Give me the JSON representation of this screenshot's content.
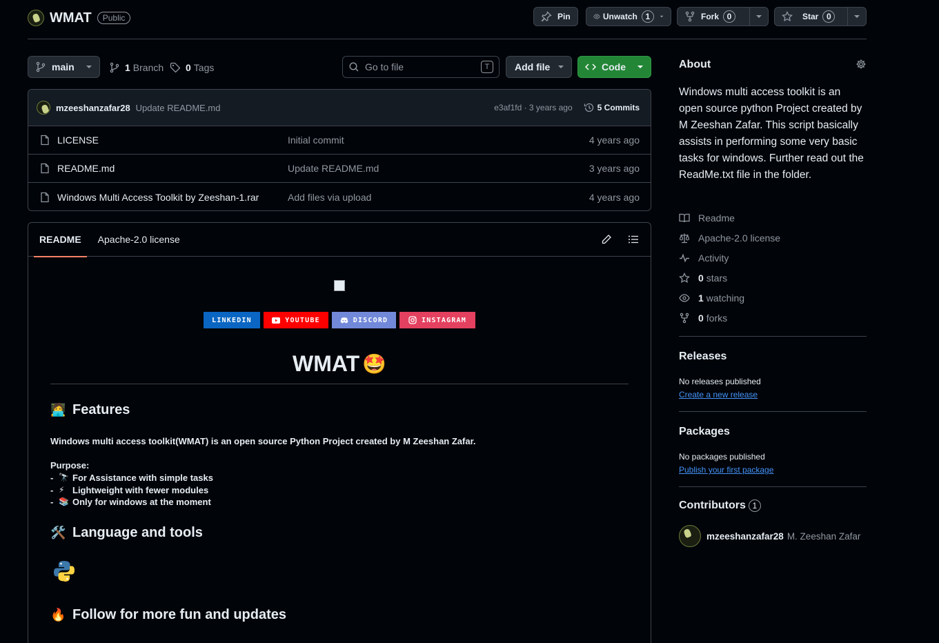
{
  "repo": {
    "name": "WMAT",
    "visibility": "Public"
  },
  "header_actions": {
    "pin_label": "Pin",
    "watch_label": "Unwatch",
    "watch_count": "1",
    "fork_label": "Fork",
    "fork_count": "0",
    "star_label": "Star",
    "star_count": "0"
  },
  "toolbar": {
    "branch": "main",
    "branches_count": "1",
    "branches_label": "Branch",
    "tags_count": "0",
    "tags_label": "Tags",
    "go_to_file_placeholder": "Go to file",
    "go_to_file_shortcut": "T",
    "add_file_label": "Add file",
    "code_label": "Code"
  },
  "latest_commit": {
    "author": "mzeeshanzafar28",
    "message": "Update README.md",
    "hash_time": "e3af1fd · 3 years ago",
    "commits_label": "5 Commits"
  },
  "files": [
    {
      "name": "LICENSE",
      "message": "Initial commit",
      "date": "4 years ago"
    },
    {
      "name": "README.md",
      "message": "Update README.md",
      "date": "3 years ago"
    },
    {
      "name": "Windows Multi Access Toolkit by Zeeshan-1.rar",
      "message": "Add files via upload",
      "date": "4 years ago"
    }
  ],
  "readme": {
    "tabs": [
      "README",
      "Apache-2.0 license"
    ],
    "socials": [
      {
        "label": "LINKEDIN",
        "color": "#0a66c2"
      },
      {
        "label": "YOUTUBE",
        "color": "#ff0000"
      },
      {
        "label": "DISCORD",
        "color": "#7289da"
      },
      {
        "label": "INSTAGRAM",
        "color": "#e4405f"
      }
    ],
    "title": "WMAT",
    "title_emoji": "🤩",
    "features_heading": "Features",
    "features_emoji": "🧑‍💻",
    "intro": "Windows multi access toolkit(WMAT) is an open source Python Project created by M Zeeshan Zafar.",
    "purpose_label": "Purpose:",
    "purposes": [
      {
        "emoji": "🔭",
        "text": "For Assistance with simple tasks"
      },
      {
        "emoji": "⚡",
        "text": "Lightweight with fewer modules"
      },
      {
        "emoji": "📚",
        "text": "Only for windows at the moment"
      }
    ],
    "tools_heading": "Language and tools",
    "tools_emoji": "🛠️",
    "follow_heading": "Follow for more fun and updates",
    "follow_emoji": "🔥"
  },
  "about": {
    "title": "About",
    "description": "Windows multi access toolkit is an open source python Project created by M Zeeshan Zafar. This script basically assists in performing some very basic tasks for windows. Further read out the ReadMe.txt file in the folder.",
    "readme_label": "Readme",
    "license_label": "Apache-2.0 license",
    "activity_label": "Activity",
    "stars_count": "0",
    "stars_label": "stars",
    "watching_count": "1",
    "watching_label": "watching",
    "forks_count": "0",
    "forks_label": "forks"
  },
  "releases": {
    "title": "Releases",
    "empty": "No releases published",
    "link": "Create a new release"
  },
  "packages": {
    "title": "Packages",
    "empty": "No packages published",
    "link": "Publish your first package"
  },
  "contributors": {
    "title": "Contributors",
    "count": "1",
    "list": [
      {
        "login": "mzeeshanzafar28",
        "name": "M. Zeeshan Zafar"
      }
    ]
  },
  "colors": {
    "accent_green": "#238636",
    "link": "#4493f8",
    "tab_underline": "#f78166"
  }
}
